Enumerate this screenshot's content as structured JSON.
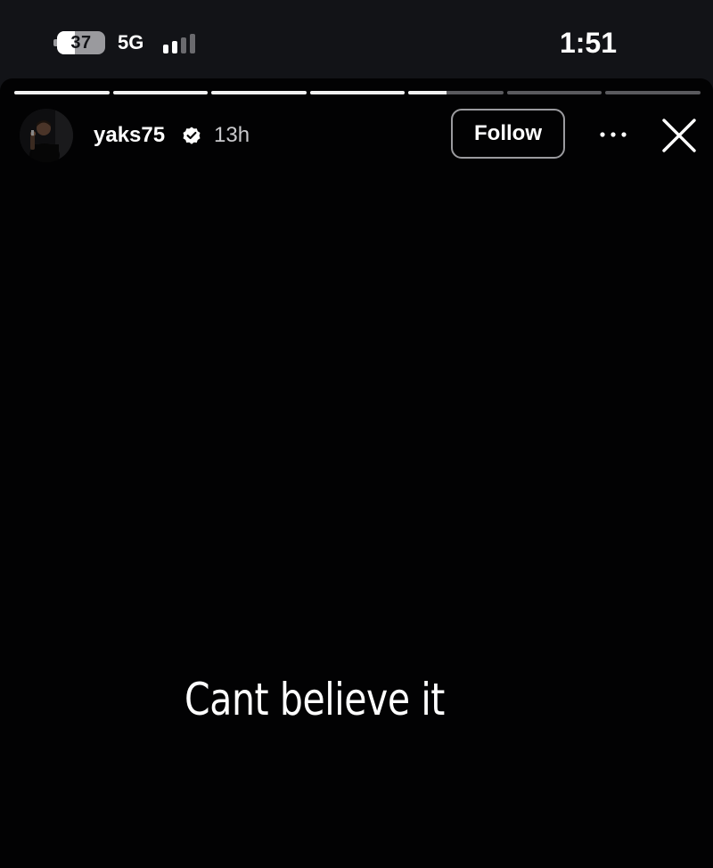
{
  "status_bar": {
    "battery_level": "37",
    "battery_fraction": 0.37,
    "network": "5G",
    "signal_bars_active": 2,
    "signal_bars_total": 4,
    "time": "1:51"
  },
  "story": {
    "progress_segments": [
      1,
      1,
      1,
      1,
      0.4,
      0,
      0
    ],
    "username": "yaks75",
    "verified": true,
    "time_ago": "13h",
    "follow_label": "Follow",
    "text": "Cant believe it"
  },
  "colors": {
    "background": "#020203",
    "status_bar": "#121317",
    "text": "#ffffff"
  }
}
